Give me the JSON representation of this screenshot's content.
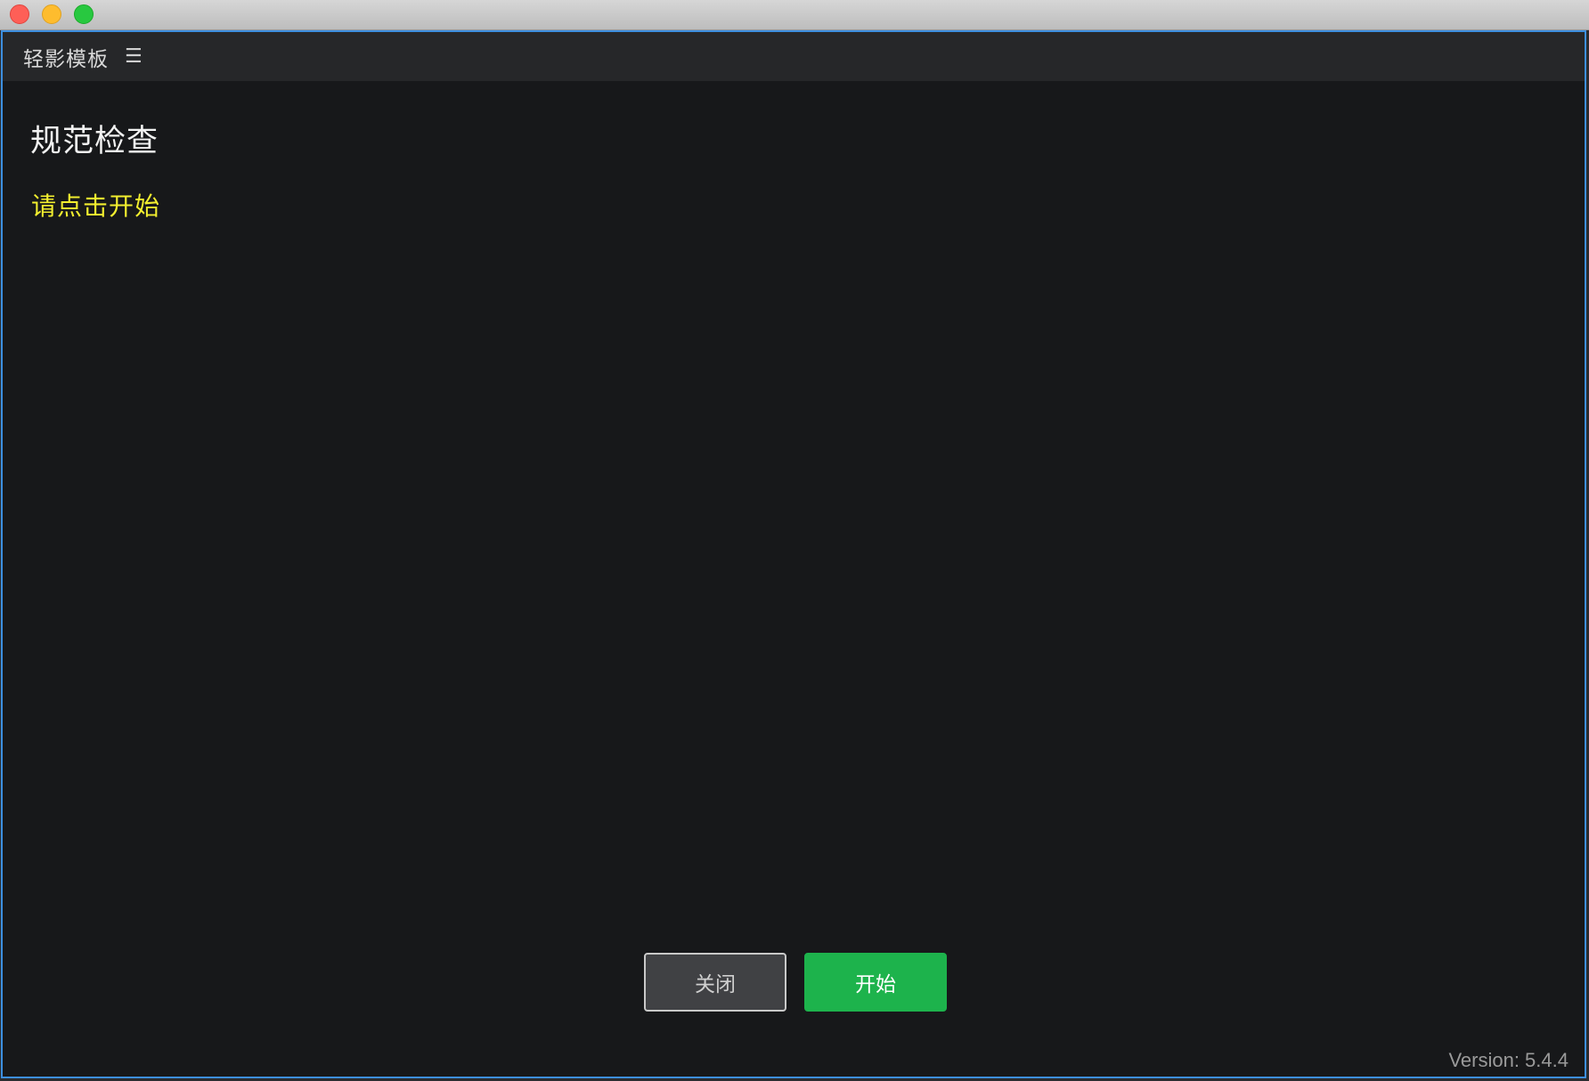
{
  "window": {
    "controls": [
      "close",
      "minimize",
      "zoom"
    ]
  },
  "app": {
    "name": "轻影模板",
    "menu_icon": "hamburger-menu-icon"
  },
  "main": {
    "title": "规范检查",
    "status": "请点击开始"
  },
  "actions": {
    "close_label": "关闭",
    "start_label": "开始"
  },
  "footer": {
    "version": "Version: 5.4.4"
  },
  "colors": {
    "accent_border": "#3d8fe0",
    "status_text": "#f2ee2f",
    "start_button": "#1db34c",
    "background": "#17181a",
    "header": "#262729"
  }
}
